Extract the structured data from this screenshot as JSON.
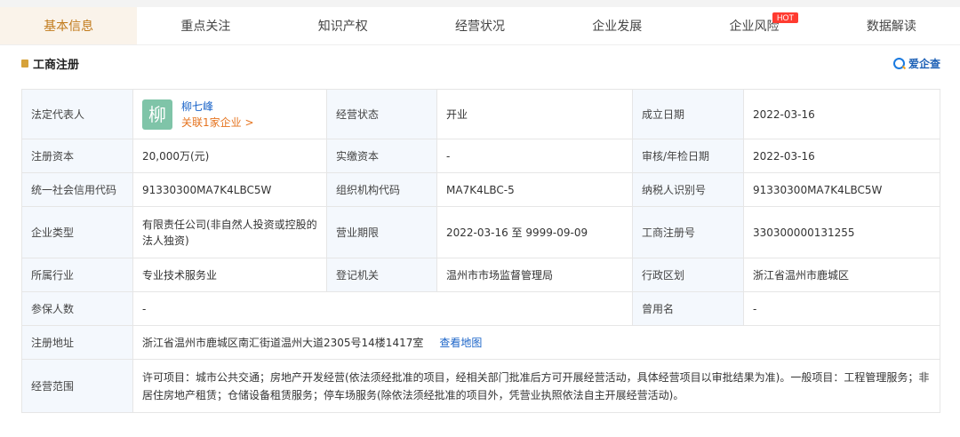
{
  "tabs": [
    "基本信息",
    "重点关注",
    "知识产权",
    "经营状况",
    "企业发展",
    "企业风险",
    "数据解读"
  ],
  "hot_badge": "HOT",
  "section": {
    "title": "工商注册",
    "brand": "爱企查"
  },
  "rows": {
    "legal_rep_label": "法定代表人",
    "avatar_char": "柳",
    "legal_rep_name": "柳七峰",
    "legal_rep_link": "关联1家企业 >",
    "status_label": "经营状态",
    "status_value": "开业",
    "founded_label": "成立日期",
    "founded_value": "2022-03-16",
    "reg_capital_label": "注册资本",
    "reg_capital_value": "20,000万(元)",
    "paid_capital_label": "实缴资本",
    "paid_capital_value": "-",
    "audit_date_label": "审核/年检日期",
    "audit_date_value": "2022-03-16",
    "credit_code_label": "统一社会信用代码",
    "credit_code_value": "91330300MA7K4LBC5W",
    "org_code_label": "组织机构代码",
    "org_code_value": "MA7K4LBC-5",
    "taxpayer_label": "纳税人识别号",
    "taxpayer_value": "91330300MA7K4LBC5W",
    "type_label": "企业类型",
    "type_value": "有限责任公司(非自然人投资或控股的法人独资)",
    "term_label": "营业期限",
    "term_value": "2022-03-16 至 9999-09-09",
    "reg_no_label": "工商注册号",
    "reg_no_value": "330300000131255",
    "industry_label": "所属行业",
    "industry_value": "专业技术服务业",
    "authority_label": "登记机关",
    "authority_value": "温州市市场监督管理局",
    "district_label": "行政区划",
    "district_value": "浙江省温州市鹿城区",
    "insured_label": "参保人数",
    "insured_value": "-",
    "former_name_label": "曾用名",
    "former_name_value": "-",
    "address_label": "注册地址",
    "address_value": "浙江省温州市鹿城区南汇街道温州大道2305号14楼1417室",
    "map_link": "查看地图",
    "scope_label": "经营范围",
    "scope_value": "许可项目：城市公共交通；房地产开发经营(依法须经批准的项目，经相关部门批准后方可开展经营活动，具体经营项目以审批结果为准)。一般项目：工程管理服务；非居住房地产租赁；仓储设备租赁服务；停车场服务(除依法须经批准的项目外，凭营业执照依法自主开展经营活动)。"
  }
}
